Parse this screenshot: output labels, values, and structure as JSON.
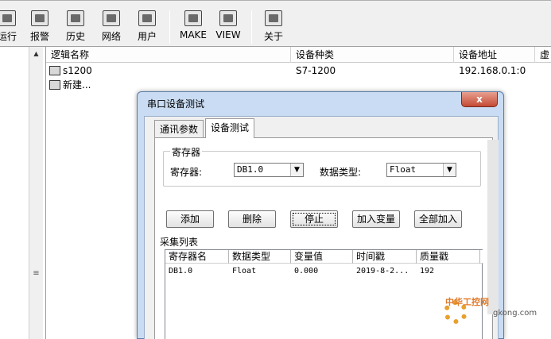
{
  "toolbar": {
    "items": [
      {
        "label": "运行",
        "icon": "run-icon"
      },
      {
        "label": "报警",
        "icon": "alarm-icon"
      },
      {
        "label": "历史",
        "icon": "history-icon"
      },
      {
        "label": "网络",
        "icon": "network-icon"
      },
      {
        "label": "用户",
        "icon": "user-key-icon"
      },
      {
        "label": "MAKE",
        "icon": "make-icon"
      },
      {
        "label": "VIEW",
        "icon": "view-icon"
      },
      {
        "label": "关于",
        "icon": "about-icon"
      }
    ]
  },
  "list": {
    "columns": [
      "逻辑名称",
      "设备种类",
      "设备地址",
      "虚"
    ],
    "rows": [
      {
        "name": "s1200",
        "type": "S7-1200",
        "address": "192.168.0.1:0"
      },
      {
        "name": "新建..."
      }
    ]
  },
  "dialog": {
    "title": "串口设备测试",
    "close": "x",
    "tabs": [
      "通讯参数",
      "设备测试"
    ],
    "register_group": {
      "title": "寄存器",
      "register_label": "寄存器:",
      "register_value": "DB1.0",
      "type_label": "数据类型:",
      "type_value": "Float"
    },
    "buttons": [
      "添加",
      "删除",
      "停止",
      "加入变量",
      "全部加入"
    ],
    "collection_label": "采集列表",
    "grid": {
      "columns": [
        "寄存器名",
        "数据类型",
        "变量值",
        "时间戳",
        "质量戳"
      ],
      "rows": [
        [
          "DB1.0",
          "Float",
          "0.000",
          "2019-8-2...",
          "192"
        ]
      ]
    }
  },
  "watermark": {
    "text": "中华工控网",
    "url": "gkong.com"
  }
}
